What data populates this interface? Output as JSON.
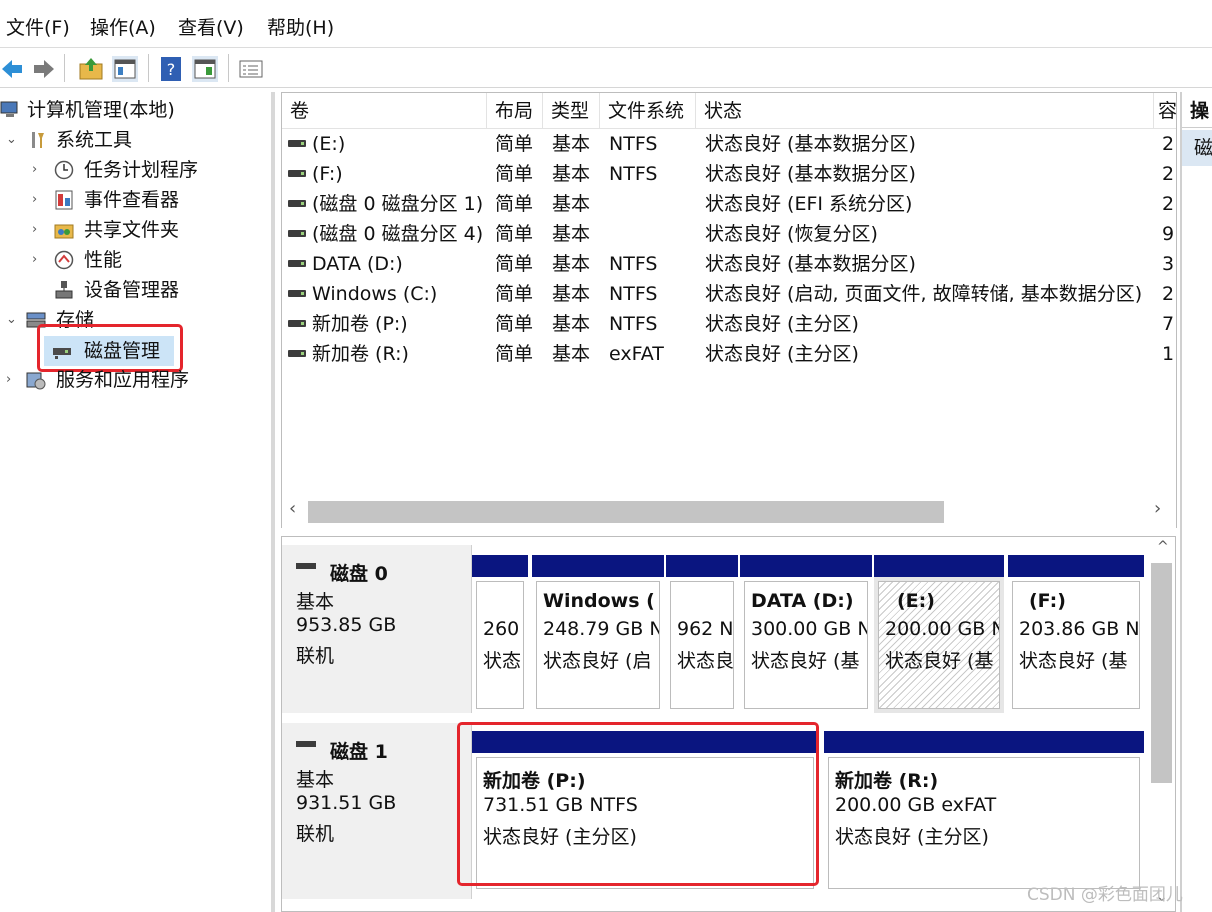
{
  "menu": {
    "file": "文件(F)",
    "action": "操作(A)",
    "view": "查看(V)",
    "help": "帮助(H)"
  },
  "tree": {
    "root": "计算机管理(本地)",
    "system_tools": "系统工具",
    "task_scheduler": "任务计划程序",
    "event_viewer": "事件查看器",
    "shared_folders": "共享文件夹",
    "performance": "性能",
    "device_manager": "设备管理器",
    "storage": "存储",
    "disk_management": "磁盘管理",
    "services": "服务和应用程序"
  },
  "list": {
    "headers": {
      "volume": "卷",
      "layout": "布局",
      "type": "类型",
      "fs": "文件系统",
      "status": "状态",
      "capacity": "容"
    },
    "rows": [
      {
        "volume": "(E:)",
        "layout": "简单",
        "type": "基本",
        "fs": "NTFS",
        "status": "状态良好 (基本数据分区)",
        "cap": "2"
      },
      {
        "volume": "(F:)",
        "layout": "简单",
        "type": "基本",
        "fs": "NTFS",
        "status": "状态良好 (基本数据分区)",
        "cap": "2"
      },
      {
        "volume": "(磁盘 0 磁盘分区 1)",
        "layout": "简单",
        "type": "基本",
        "fs": "",
        "status": "状态良好 (EFI 系统分区)",
        "cap": "2"
      },
      {
        "volume": "(磁盘 0 磁盘分区 4)",
        "layout": "简单",
        "type": "基本",
        "fs": "",
        "status": "状态良好 (恢复分区)",
        "cap": "9"
      },
      {
        "volume": "DATA (D:)",
        "layout": "简单",
        "type": "基本",
        "fs": "NTFS",
        "status": "状态良好 (基本数据分区)",
        "cap": "3"
      },
      {
        "volume": "Windows (C:)",
        "layout": "简单",
        "type": "基本",
        "fs": "NTFS",
        "status": "状态良好 (启动, 页面文件, 故障转储, 基本数据分区)",
        "cap": "2"
      },
      {
        "volume": "新加卷 (P:)",
        "layout": "简单",
        "type": "基本",
        "fs": "NTFS",
        "status": "状态良好 (主分区)",
        "cap": "7"
      },
      {
        "volume": "新加卷 (R:)",
        "layout": "简单",
        "type": "基本",
        "fs": "exFAT",
        "status": "状态良好 (主分区)",
        "cap": "1"
      }
    ],
    "scroll_left": "‹",
    "scroll_right": "›"
  },
  "actions": {
    "header": "操",
    "item": "磁"
  },
  "disks": [
    {
      "name": "磁盘 0",
      "type": "基本",
      "size": "953.85 GB",
      "state": "联机",
      "partitions": [
        {
          "title": "",
          "size": "260",
          "status": "状态"
        },
        {
          "title": "Windows (",
          "size": "248.79 GB N",
          "status": "状态良好 (启"
        },
        {
          "title": "",
          "size": "962 N",
          "status": "状态良"
        },
        {
          "title": "DATA  (D:)",
          "size": "300.00 GB N",
          "status": "状态良好 (基"
        },
        {
          "title": "(E:)",
          "size": "200.00 GB N",
          "status": "状态良好 (基"
        },
        {
          "title": "(F:)",
          "size": "203.86 GB N",
          "status": "状态良好 (基"
        }
      ]
    },
    {
      "name": "磁盘 1",
      "type": "基本",
      "size": "931.51 GB",
      "state": "联机",
      "partitions": [
        {
          "title": "新加卷  (P:)",
          "size": "731.51 GB NTFS",
          "status": "状态良好 (主分区)"
        },
        {
          "title": "新加卷  (R:)",
          "size": "200.00 GB exFAT",
          "status": "状态良好 (主分区)"
        }
      ]
    }
  ],
  "panel_scroll_up": "^",
  "panel_scroll_down": "⌄",
  "watermark": "CSDN @彩色面团儿",
  "colors": {
    "partition_bar": "#0a1580",
    "highlight_box": "#e4252c",
    "selected": "#cce4f7"
  }
}
